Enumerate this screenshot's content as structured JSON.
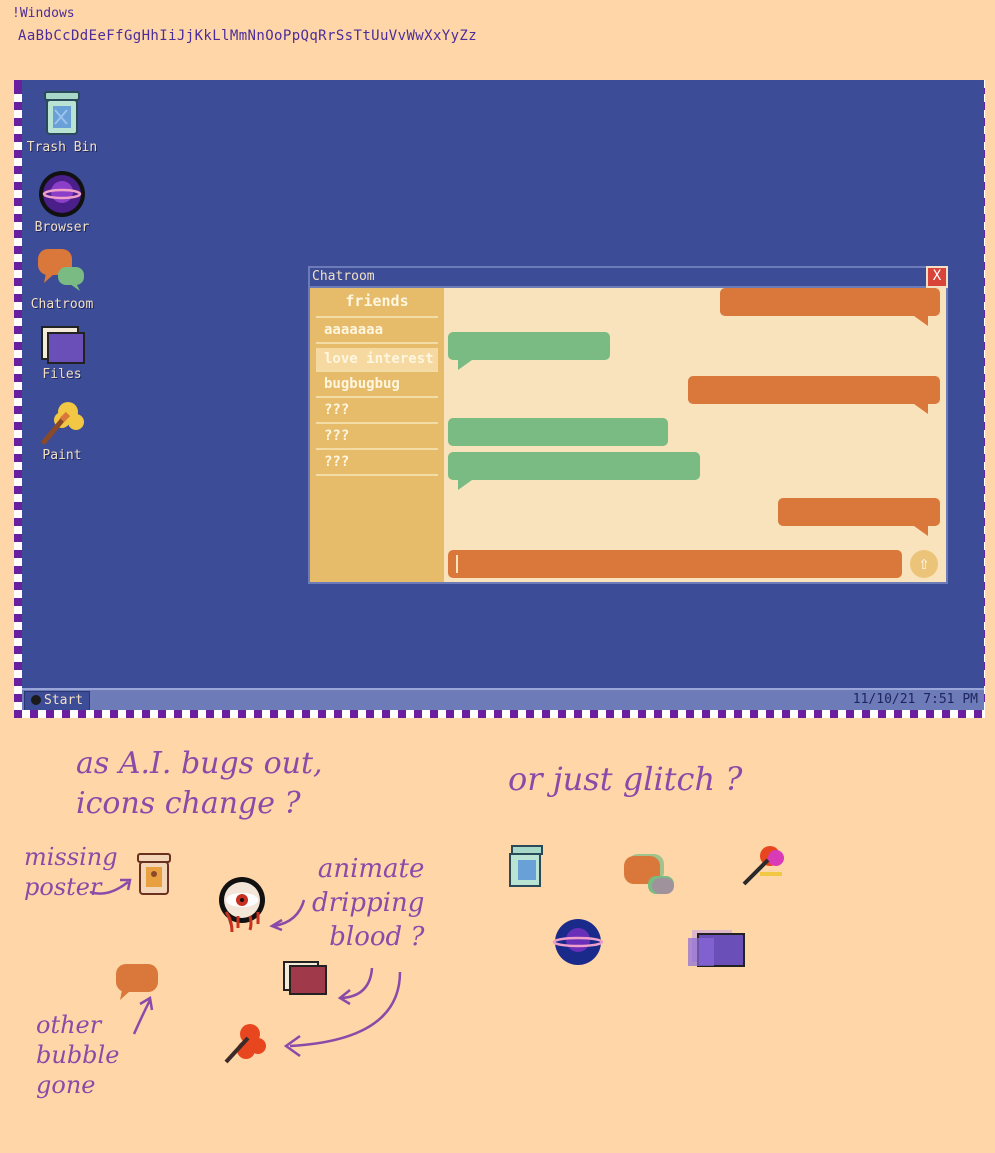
{
  "header": {
    "title": "!Windows",
    "alphabet": "AaBbCcDdEeFfGgHhIiJjKkLlMmNnOoPpQqRrSsTtUuVvWwXxYyZz"
  },
  "desktop": {
    "icons": [
      {
        "label": "Trash Bin",
        "icon": "trash-bin-icon"
      },
      {
        "label": "Browser",
        "icon": "planet-icon"
      },
      {
        "label": "Chatroom",
        "icon": "chat-bubbles-icon"
      },
      {
        "label": "Files",
        "icon": "folder-icon"
      },
      {
        "label": "Paint",
        "icon": "paint-brush-icon"
      }
    ]
  },
  "chat": {
    "title": "Chatroom",
    "close_label": "X",
    "friends_header": "friends",
    "friends": [
      "aaaaaaa",
      "love interest",
      "bugbugbug",
      "???",
      "???",
      "???"
    ],
    "active_friend": "love interest",
    "send_icon": "up-arrow-icon"
  },
  "taskbar": {
    "start_label": "Start",
    "clock": "11/10/21  7:51 PM"
  },
  "notes": {
    "ai_bugs": "as A.I. bugs out,\nicons change ?",
    "glitch": "or just glitch ?",
    "missing_poster": "missing\nposter",
    "dripping": "animate\ndripping\nblood ?",
    "bubble_gone": "other\nbubble\ngone"
  },
  "colors": {
    "desktop": "#3c4c96",
    "outgoing_bubble": "#d9783a",
    "incoming_bubble": "#79bb82",
    "friends_panel": "#e6bb6a",
    "frame_check": "#6a1fa0"
  }
}
